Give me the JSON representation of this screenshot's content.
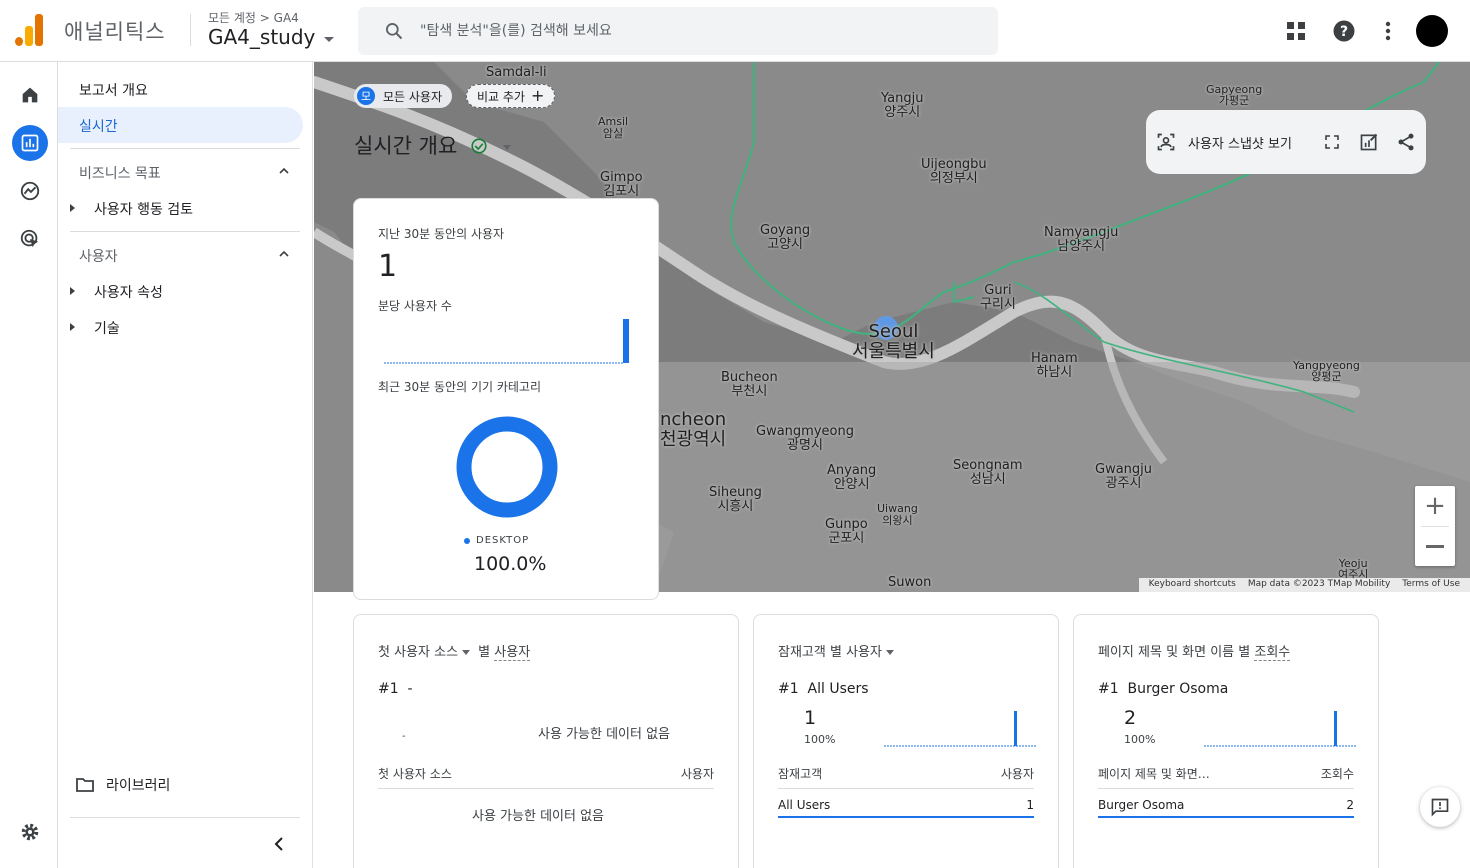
{
  "header": {
    "app_name": "애널리틱스",
    "account_crumb": "모든 계정 > GA4",
    "property_name": "GA4_study",
    "search_placeholder": "\"탐색 분석\"을(를) 검색해 보세요"
  },
  "nav": {
    "overview": "보고서 개요",
    "realtime": "실시간",
    "section_business": "비즈니스 목표",
    "business_items": [
      "사용자 행동 검토"
    ],
    "section_user": "사용자",
    "user_items": [
      "사용자 속성",
      "기술"
    ],
    "library": "라이브러리"
  },
  "toolbar": {
    "all_users_badge": "모",
    "all_users_chip": "모든 사용자",
    "add_compare_chip": "비교 추가",
    "page_title": "실시간 개요",
    "snapshot_label": "사용자 스냅샷 보기"
  },
  "map": {
    "labels": [
      {
        "en": "Samdal-li",
        "ko": ""
      },
      {
        "en": "Yangju",
        "ko": "양주시"
      },
      {
        "en": "Gapyeong",
        "ko": "가평군"
      },
      {
        "en": "Amsil",
        "ko": "암실"
      },
      {
        "en": "Gimpo",
        "ko": "김포시"
      },
      {
        "en": "Uijeongbu",
        "ko": "의정부시"
      },
      {
        "en": "Goyang",
        "ko": "고양시"
      },
      {
        "en": "Namyangju",
        "ko": "남양주시"
      },
      {
        "en": "Guri",
        "ko": "구리시"
      },
      {
        "en": "Seoul",
        "ko": "서울특별시"
      },
      {
        "en": "Hanam",
        "ko": "하남시"
      },
      {
        "en": "Yangpyeong",
        "ko": "양평군"
      },
      {
        "en": "Bucheon",
        "ko": "부천시"
      },
      {
        "en": "ncheon",
        "ko": "천광역시"
      },
      {
        "en": "Gwangmyeong",
        "ko": "광명시"
      },
      {
        "en": "Anyang",
        "ko": "안양시"
      },
      {
        "en": "Seongnam",
        "ko": "성남시"
      },
      {
        "en": "Gwangju",
        "ko": "광주시"
      },
      {
        "en": "Siheung",
        "ko": "시흥시"
      },
      {
        "en": "Uiwang",
        "ko": "의왕시"
      },
      {
        "en": "Gunpo",
        "ko": "군포시"
      },
      {
        "en": "Suwon",
        "ko": ""
      },
      {
        "en": "Yeoju",
        "ko": "여주시"
      }
    ],
    "footer_shortcuts": "Keyboard shortcuts",
    "footer_data": "Map data ©2023 TMap Mobility",
    "footer_terms": "Terms of Use"
  },
  "realtime_card": {
    "users_30min_label": "지난 30분 동안의 사용자",
    "users_30min_value": "1",
    "per_minute_label": "분당 사용자 수",
    "device_label": "최근 30분 동안의 기기 카테고리",
    "device_legend": "DESKTOP",
    "device_percent": "100.0%"
  },
  "source_card": {
    "title_dim": "첫 사용자 소스",
    "title_suffix": "별",
    "title_metric": "사용자",
    "rank": "#1",
    "rank_value": "-",
    "no_data": "사용 가능한 데이터 없음",
    "dash": "-",
    "col_dim": "첫 사용자 소스",
    "col_metric": "사용자",
    "no_data_table": "사용 가능한 데이터 없음"
  },
  "audience_card": {
    "title_dim": "잠재고객",
    "title_suffix": "별",
    "title_metric": "사용자",
    "rank": "#1",
    "rank_value": "All Users",
    "value": "1",
    "percent": "100%",
    "col_dim": "잠재고객",
    "col_metric": "사용자",
    "row_name": "All Users",
    "row_value": "1"
  },
  "page_card": {
    "title_dim": "페이지 제목 및 화면 이름",
    "title_suffix": "별",
    "title_metric": "조회수",
    "rank": "#1",
    "rank_value": "Burger Osoma",
    "value": "2",
    "percent": "100%",
    "col_dim": "페이지 제목 및 화면…",
    "col_metric": "조회수",
    "row_name": "Burger Osoma",
    "row_value": "2"
  },
  "colors": {
    "accent": "#1a73e8",
    "map_bg": "#8a8a8a",
    "map_road": "#3fb37f"
  },
  "chart_data": [
    {
      "type": "bar",
      "title": "분당 사용자 수",
      "categories_count": 30,
      "values": [
        0,
        0,
        0,
        0,
        0,
        0,
        0,
        0,
        0,
        0,
        0,
        0,
        0,
        0,
        0,
        0,
        0,
        0,
        0,
        0,
        0,
        0,
        0,
        0,
        0,
        0,
        0,
        0,
        0,
        1
      ]
    },
    {
      "type": "pie",
      "title": "최근 30분 동안의 기기 카테고리",
      "categories": [
        "DESKTOP"
      ],
      "values": [
        100.0
      ]
    }
  ]
}
